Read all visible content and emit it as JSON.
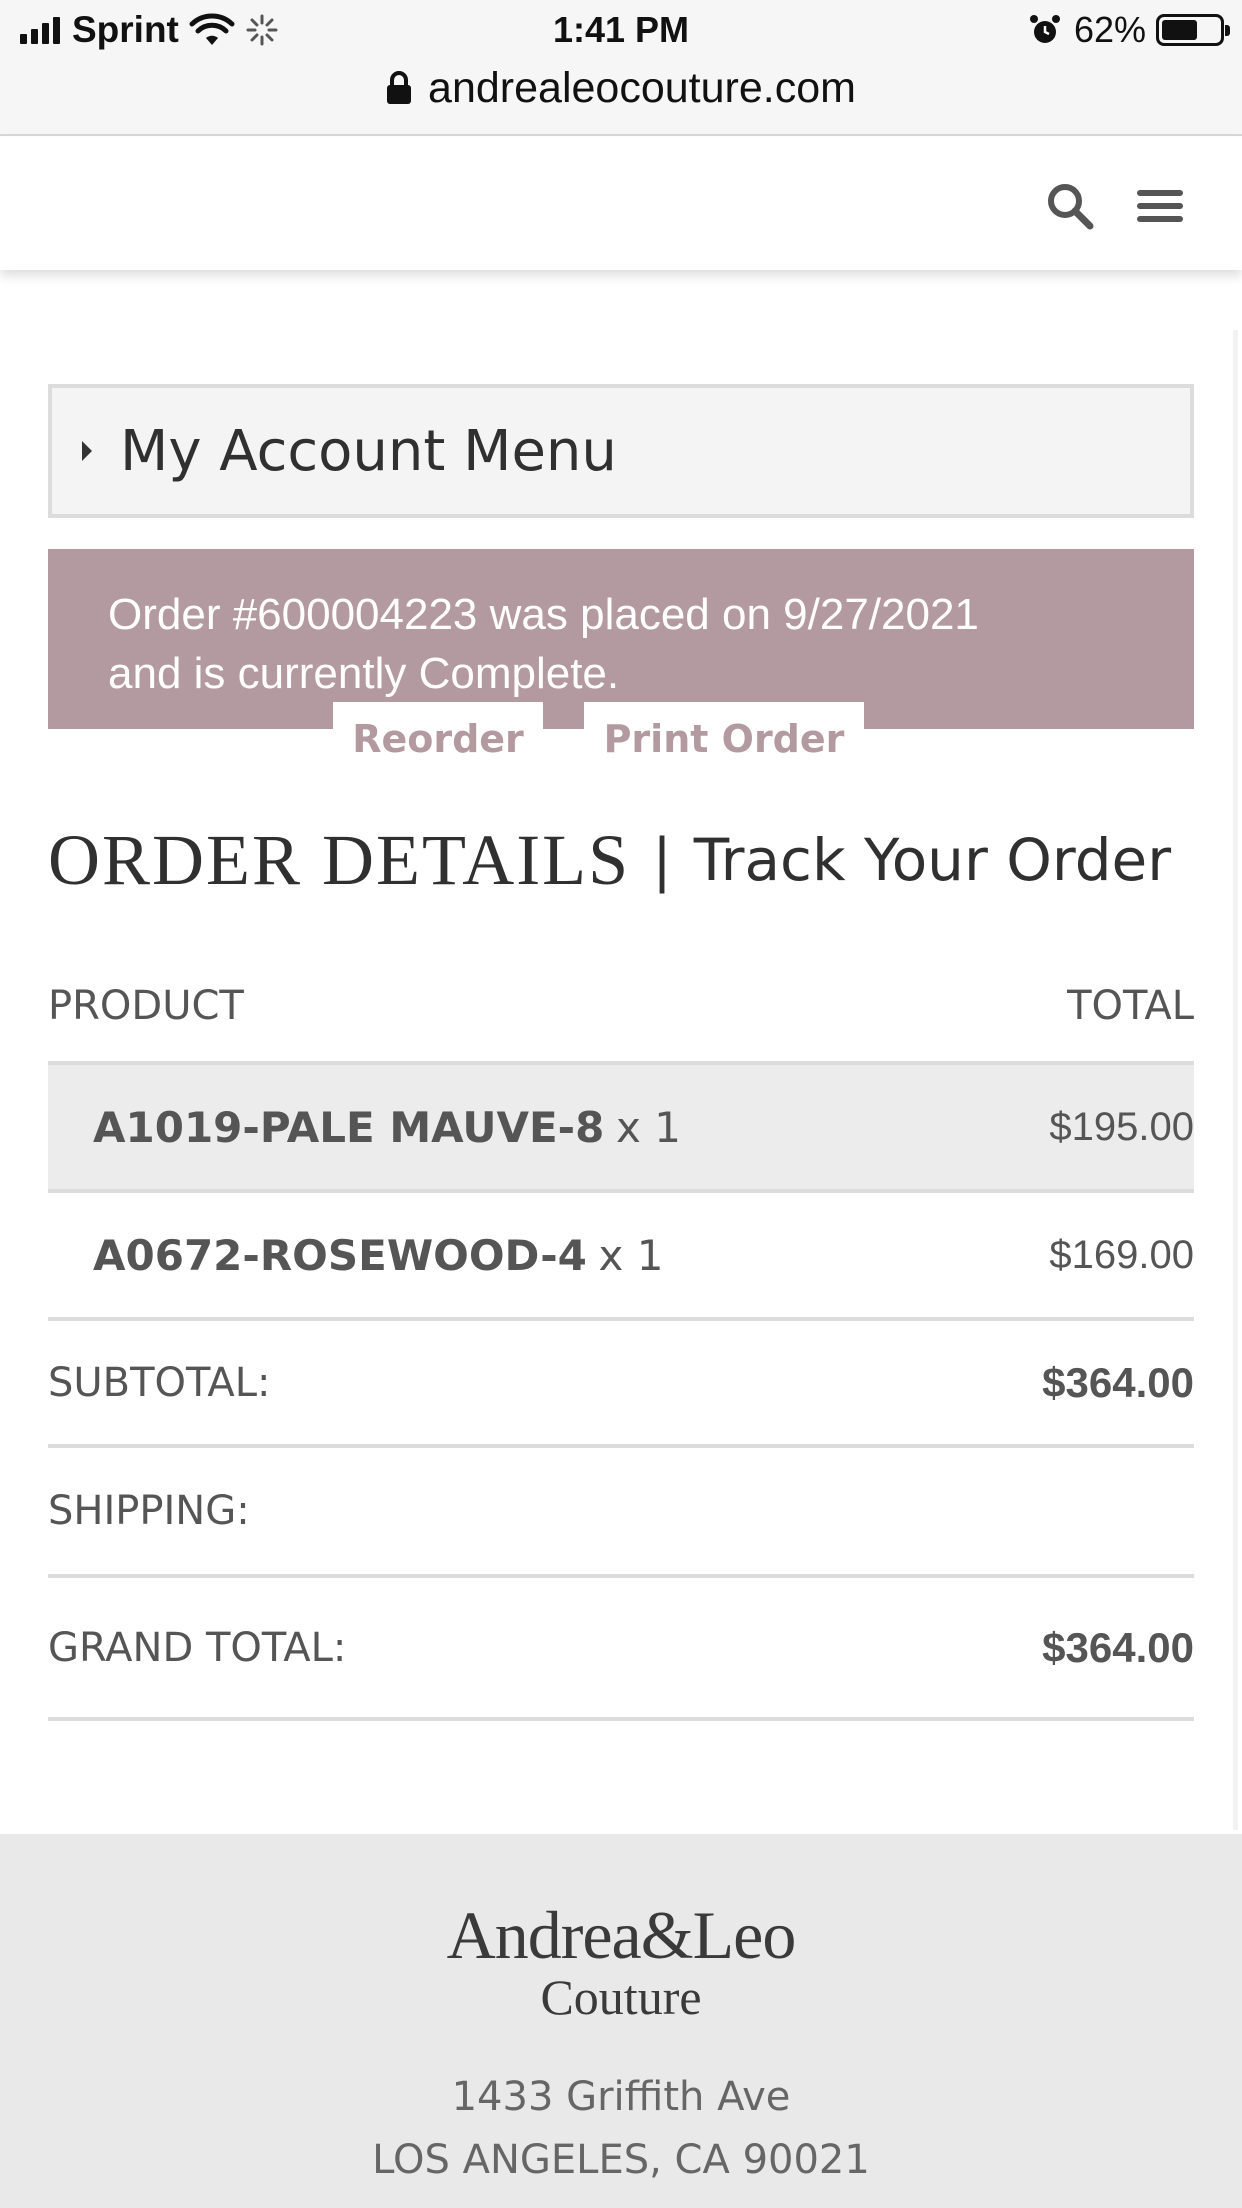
{
  "status_bar": {
    "carrier": "Sprint",
    "time": "1:41 PM",
    "battery": "62%",
    "battery_level": 0.62,
    "url": "andrealeocouture.com"
  },
  "header": {
    "icons": [
      "search-icon",
      "hamburger-menu-icon"
    ]
  },
  "account_menu": {
    "label": "My Account Menu"
  },
  "order_notice": {
    "line1": "Order #600004223 was placed on 9/27/2021",
    "line2": "and is currently Complete."
  },
  "actions": {
    "reorder": "Reorder",
    "print": "Print Order"
  },
  "title": {
    "main": "ORDER DETAILS",
    "separator": "|",
    "link": "Track Your Order"
  },
  "table": {
    "col_product": "PRODUCT",
    "col_total": "TOTAL",
    "items": [
      {
        "code": "A1019-PALE MAUVE-8",
        "qty": "x 1",
        "price": "$195.00"
      },
      {
        "code": "A0672-ROSEWOOD-4",
        "qty": "x 1",
        "price": "$169.00"
      }
    ],
    "subtotal_label": "SUBTOTAL:",
    "subtotal_value": "$364.00",
    "shipping_label": "SHIPPING:",
    "grand_total_label": "GRAND TOTAL:",
    "grand_total_value": "$364.00"
  },
  "footer": {
    "brand": "Andrea&Leo",
    "brand_sub": "Couture",
    "address1": "1433 Griffith Ave",
    "address2": "LOS ANGELES, CA 90021"
  },
  "colors": {
    "accent": "#b39aa0",
    "footer_bg": "#e9e9e9",
    "row_shade": "#ececec"
  }
}
